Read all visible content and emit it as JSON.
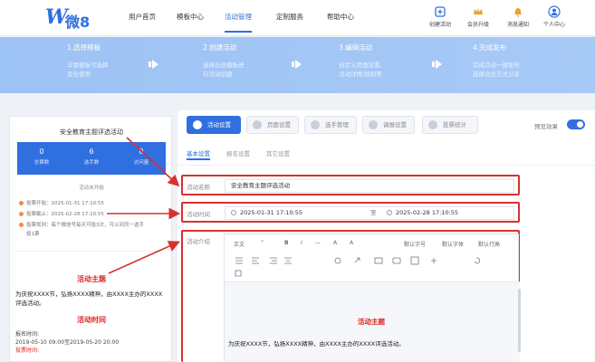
{
  "brand": {
    "logo_letter": "W",
    "logo_text": "微8"
  },
  "nav": {
    "items": [
      {
        "label": "用户首页"
      },
      {
        "label": "模板中心"
      },
      {
        "label": "活动管理"
      },
      {
        "label": "定制服务"
      },
      {
        "label": "帮助中心"
      }
    ],
    "tools": [
      {
        "label": "创建活动",
        "icon": "create-activity-icon"
      },
      {
        "label": "会员升级",
        "icon": "crown-icon"
      },
      {
        "label": "消息通知",
        "icon": "bell-icon"
      },
      {
        "label": "个人中心",
        "icon": "user-icon"
      }
    ]
  },
  "steps": [
    {
      "title": "1.选择模板",
      "desc": [
        "丰富模板可选择",
        "变化使用"
      ]
    },
    {
      "title": "2.创建活动",
      "desc": [
        "选择合适模板进",
        "行活动创建"
      ]
    },
    {
      "title": "3.编辑活动",
      "desc": [
        "自定义页面设置,",
        "活动详情/规则等"
      ]
    },
    {
      "title": "4.完成发布",
      "desc": [
        "完成活动一键发布",
        "选择合适方式分享"
      ]
    }
  ],
  "preview": {
    "title": "安全教育主题评选活动",
    "stats": [
      {
        "value": "0",
        "label": "总票数"
      },
      {
        "value": "6",
        "label": "选手数"
      },
      {
        "value": "0",
        "label": "访问量"
      }
    ],
    "status": "活动未开始",
    "rows": [
      "投票开始：2025-01-31 17:10:55",
      "投票截止：2025-02-28 17:10:55",
      "投票规则：每个微信号每天可投3次，可以对同一选手",
      "投1票"
    ],
    "card": {
      "theme_heading": "活动主题",
      "theme_text": "为庆祝XXXX节，弘扬XXXX精神，由XXXX主办的XXXX评选活动。",
      "time_heading": "活动时间",
      "signup_label": "报名时间:",
      "signup_value": "2019-05-10 09:00至2019-05-20 20:00",
      "vote_label": "投票时间:"
    }
  },
  "tabs": [
    {
      "label": "活动设置"
    },
    {
      "label": "页面设置"
    },
    {
      "label": "选手管理"
    },
    {
      "label": "调报设置"
    },
    {
      "label": "投票统计"
    }
  ],
  "preview_effect_label": "预览效果",
  "subtabs": [
    {
      "label": "基本设置"
    },
    {
      "label": "报名设置"
    },
    {
      "label": "其它设置"
    }
  ],
  "form": {
    "name_label": "活动名称",
    "name_value": "安全教育主题评选活动",
    "time_label": "活动时间",
    "start_time": "2025-01-31 17:10:55",
    "time_separator": "至",
    "end_time": "2025-02-28 17:10:55",
    "intro_label": "活动介绍"
  },
  "editor": {
    "toolbar_row1": [
      "正文",
      "“",
      "B",
      "I",
      "—",
      "A",
      "A",
      "默认字号",
      "默认字体",
      "默认行高"
    ],
    "doc_heading": "活动主题",
    "doc_text": "为庆祝XXXX节，弘扬XXXX精神，由XXXX主办的XXXX评选活动。"
  },
  "colors": {
    "accent": "#2f6fe0",
    "highlight": "#d93030",
    "danger_text": "#dd2222"
  }
}
